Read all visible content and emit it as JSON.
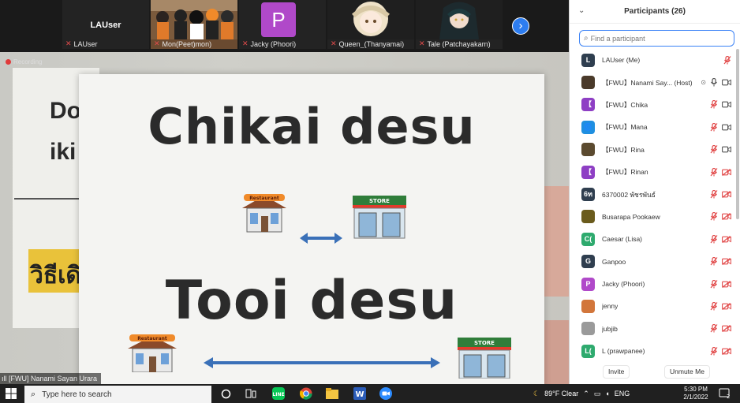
{
  "thumbnails": [
    {
      "name": "LAUser",
      "center_label": "LAUser"
    },
    {
      "name": "Mon(Peet)mon)"
    },
    {
      "name": "Jacky (Phoori)",
      "avatar_letter": "P"
    },
    {
      "name": "Queen_(Thanyamai)"
    },
    {
      "name": "Tale (Patchayakarn)"
    }
  ],
  "next_arrow": "›",
  "recording_label": "Recording",
  "background_sign": {
    "line1": "Do",
    "line2": "iki",
    "thai": "วิธีเดิ"
  },
  "sign": {
    "line1": "Chikai desu",
    "line2": "Tooi desu",
    "restaurant_label": "Restaurant",
    "store_label": "STORE"
  },
  "speaker_label": "[FWU] Nanami Sayan Urara",
  "panel": {
    "title": "Participants (26)",
    "search_placeholder": "Find a participant",
    "invite_label": "Invite",
    "unmute_label": "Unmute Me"
  },
  "participants": [
    {
      "initials": "L",
      "color": "#2f3e4f",
      "name": "LAUser (Me)",
      "mic": "muted",
      "cam": "none"
    },
    {
      "initials": "",
      "color": "#4a3a2a",
      "name": "【FWU】Nanami Say... (Host)",
      "mic": "on",
      "cam": "on",
      "extra": "host"
    },
    {
      "initials": "【",
      "color": "#8e3fc4",
      "name": "【FWU】Chika",
      "mic": "muted",
      "cam": "on"
    },
    {
      "initials": "🌀",
      "color": "#1f8fe0",
      "name": "【FWU】Mana",
      "mic": "muted",
      "cam": "on"
    },
    {
      "initials": "",
      "color": "#5b4a2f",
      "name": "【FWU】Rina",
      "mic": "muted",
      "cam": "on"
    },
    {
      "initials": "【",
      "color": "#8e3fc4",
      "name": "【FWU】Rinan",
      "mic": "muted",
      "cam": "off"
    },
    {
      "initials": "6ท",
      "color": "#2f3e4f",
      "name": "6370002 พัชรพันธ์",
      "mic": "muted",
      "cam": "off"
    },
    {
      "initials": "",
      "color": "#6a5b1c",
      "name": "Busarapa Pookaew",
      "mic": "muted",
      "cam": "off"
    },
    {
      "initials": "C(",
      "color": "#2eaa6e",
      "name": "Caesar (Lisa)",
      "mic": "muted",
      "cam": "off"
    },
    {
      "initials": "G",
      "color": "#2f3e4f",
      "name": "Ganpoo",
      "mic": "muted",
      "cam": "off"
    },
    {
      "initials": "P",
      "color": "#b049c9",
      "name": "Jacky (Phoori)",
      "mic": "muted",
      "cam": "off"
    },
    {
      "initials": "",
      "color": "#d2763b",
      "name": "jenny",
      "mic": "muted",
      "cam": "off"
    },
    {
      "initials": "",
      "color": "#9a9a9a",
      "name": "jubjib",
      "mic": "muted",
      "cam": "off"
    },
    {
      "initials": "L(",
      "color": "#2eaa6e",
      "name": "L (prawpanee)",
      "mic": "muted",
      "cam": "off"
    }
  ],
  "taskbar": {
    "search_placeholder": "Type here to search",
    "weather": "89°F  Clear",
    "lang": "ENG",
    "time": "5:30 PM",
    "date": "2/1/2022",
    "notif_count": "2"
  }
}
